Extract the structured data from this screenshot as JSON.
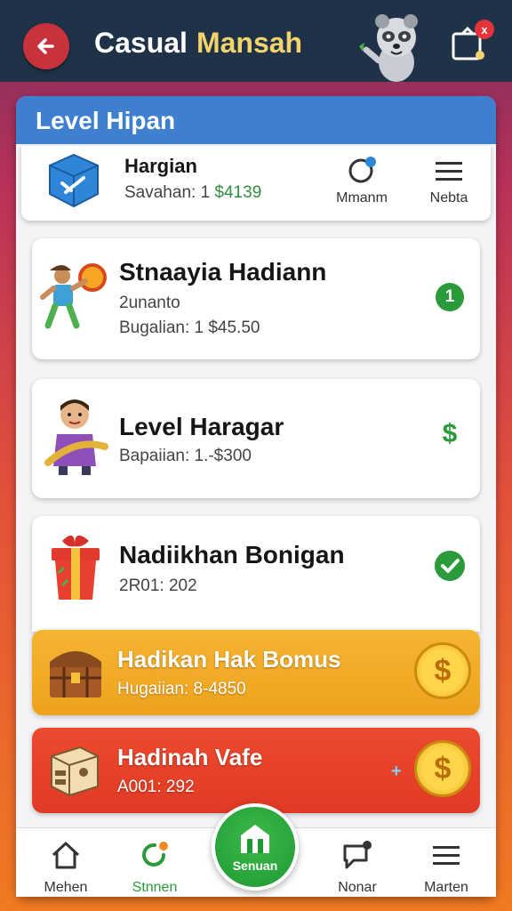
{
  "app": {
    "title_part1": "Casual",
    "title_part2": "Mansah",
    "notification_count": "x",
    "back_icon": "arrow-left-icon"
  },
  "panel": {
    "header": "Level Hipan"
  },
  "top_card": {
    "title": "Hargian",
    "sub_label": "Savahan: 1",
    "sub_price": "$4139",
    "action1_label": "Mmanm",
    "action2_label": "Nebta"
  },
  "cards": [
    {
      "title": "Stnaayia Hadiann",
      "tag": "2unanto",
      "sub": "Bugalian: 1 $45.50",
      "status_icon": "number-one-badge",
      "status_text": "1"
    },
    {
      "title": "Level Haragar",
      "sub": "Bapaiian: 1.-$300",
      "status_icon": "dollar-icon",
      "status_text": "$"
    },
    {
      "title": "Nadiikhan Bonigan",
      "sub": "2R01: 202",
      "status_icon": "check-icon"
    },
    {
      "title": "Hadikan Hak Bomus",
      "sub": "Hugaiian: 8-4850",
      "status_icon": "coin-icon",
      "status_text": "$"
    },
    {
      "title": "Hadinah Vafe",
      "sub": "A001: 292",
      "status_icon": "coin-icon",
      "status_text": "$"
    }
  ],
  "nav": [
    {
      "label": "Mehen",
      "icon": "home-icon"
    },
    {
      "label": "Stnnen",
      "icon": "refresh-icon"
    },
    {
      "label": "Senuan",
      "icon": "store-icon"
    },
    {
      "label": "Nonar",
      "icon": "chat-icon"
    },
    {
      "label": "Marten",
      "icon": "menu-icon"
    }
  ],
  "colors": {
    "topbar": "#1f3247",
    "panel_header": "#3f7fcf",
    "accent_green": "#2f9a3a",
    "gold_card": "#f5b531",
    "red_card": "#e03a24"
  }
}
